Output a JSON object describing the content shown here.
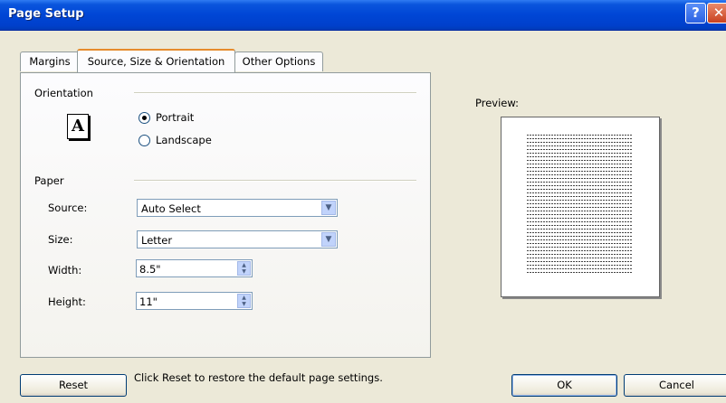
{
  "window": {
    "title": "Page Setup"
  },
  "tabs": [
    {
      "label": "Margins"
    },
    {
      "label": "Source, Size & Orientation"
    },
    {
      "label": "Other Options"
    }
  ],
  "orientation": {
    "group_label": "Orientation",
    "portrait_label": "Portrait",
    "landscape_label": "Landscape",
    "selected": "Portrait"
  },
  "paper": {
    "group_label": "Paper",
    "source_label": "Source:",
    "source_value": "Auto Select",
    "size_label": "Size:",
    "size_value": "Letter",
    "width_label": "Width:",
    "width_value": "8.5\"",
    "height_label": "Height:",
    "height_value": "11\""
  },
  "preview": {
    "label": "Preview:"
  },
  "footer": {
    "reset_label": "Reset",
    "hint": "Click Reset to restore the default page settings.",
    "ok_label": "OK",
    "cancel_label": "Cancel"
  }
}
